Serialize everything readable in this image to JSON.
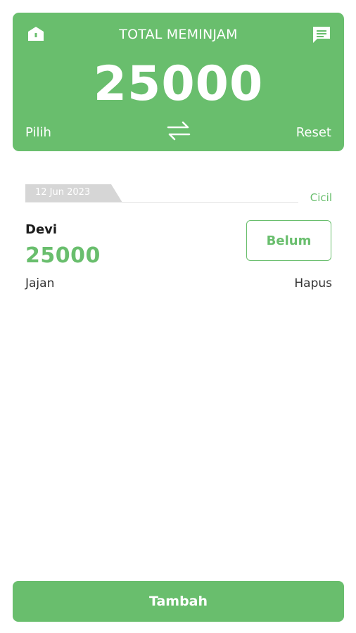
{
  "header": {
    "title": "TOTAL MEMINJAM",
    "total": "25000",
    "select_label": "Pilih",
    "reset_label": "Reset",
    "left_icon": "home-icon",
    "right_icon": "chat-icon",
    "center_icon": "swap-arrows-icon"
  },
  "entries": [
    {
      "date": "12 Jun 2023",
      "installment_label": "Cicil",
      "name": "Devi",
      "amount": "25000",
      "note": "Jajan",
      "status_label": "Belum",
      "delete_label": "Hapus"
    }
  ],
  "footer": {
    "add_label": "Tambah"
  },
  "colors": {
    "accent": "#69be6d",
    "date_tab": "#d6d6d6",
    "text_dark": "#1c1c1c",
    "text_muted": "#333333"
  }
}
